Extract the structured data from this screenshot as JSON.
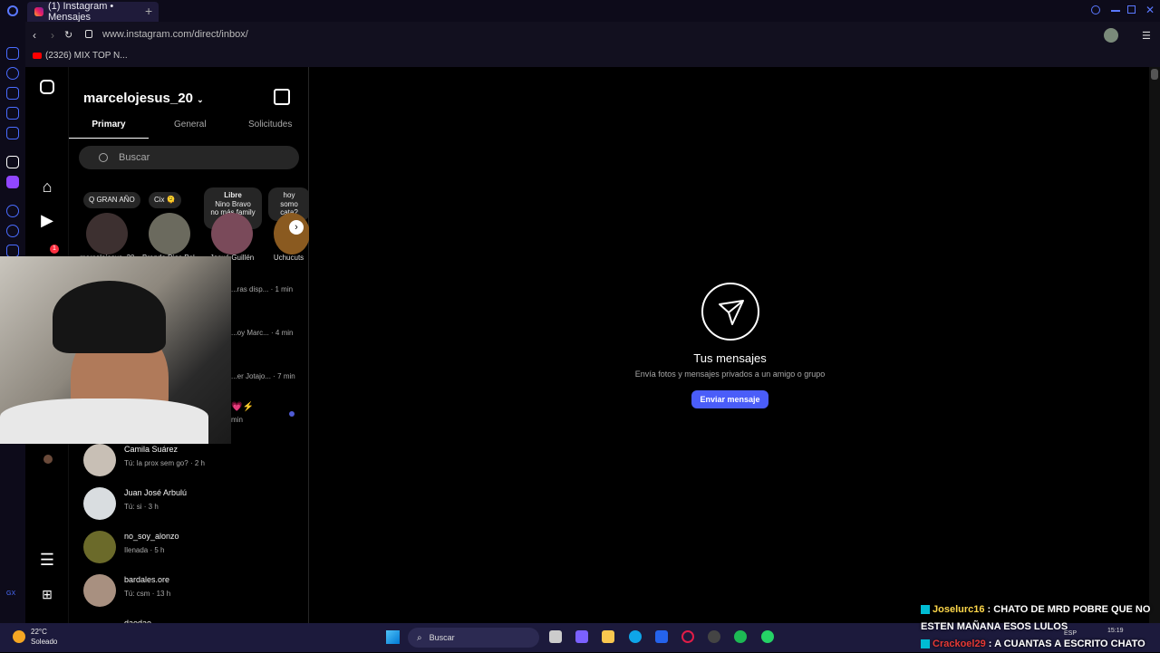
{
  "browser": {
    "tab_title": "(1) Instagram • Mensajes",
    "new_tab": "+",
    "url": "www.instagram.com/direct/inbox/",
    "bookmark": "(2326) MIX TOP N..."
  },
  "instagram": {
    "username": "marcelojesus_20",
    "tabs": [
      "Primary",
      "General",
      "Solicitudes"
    ],
    "search_placeholder": "Buscar",
    "notes": [
      {
        "text": "Q GRAN AÑO"
      },
      {
        "text": "Cix 🫠"
      },
      {
        "text": "Libre",
        "sub1": "Nino Bravo",
        "sub2": "no más family ..."
      },
      {
        "text": "hoy somo",
        "sub1": "cata?"
      }
    ],
    "stories": [
      "marcelojesus_20",
      "Brenda Dias Pal...",
      "Josué Guillén",
      "Uchucuts"
    ],
    "messages": [
      {
        "preview": "...ras disp...",
        "time": "· 1 min"
      },
      {
        "preview": "...oy Marc...",
        "time": "· 4 min"
      },
      {
        "preview": "...er Jotajo...",
        "time": "· 7 min"
      },
      {
        "preview": "💗⚡",
        "time": "min"
      },
      {
        "name": "Camila Suárez",
        "preview": "Tú: la prox sem go?",
        "time": "· 2 h"
      },
      {
        "name": "Juan José Arbulú",
        "preview": "Tú: si",
        "time": "· 3 h"
      },
      {
        "name": "no_soy_alonzo",
        "preview": "Ilenada",
        "time": "· 5 h"
      },
      {
        "name": "bardales.ore",
        "preview": "Tú: csm",
        "time": "· 13 h"
      },
      {
        "name": "daedae"
      }
    ],
    "notifications": "1",
    "empty_title": "Tus mensajes",
    "empty_sub": "Envía fotos y mensajes privados a un amigo o grupo",
    "send_button": "Enviar mensaje"
  },
  "taskbar": {
    "temp": "22°C",
    "weather": "Soleado",
    "search": "Buscar",
    "lang": "ESP",
    "time": "15:19"
  },
  "chat": [
    {
      "user": "Joselurc16",
      "text": ": CHATO DE MRD POBRE QUE NO ESTEN MAÑANA ESOS LULOS"
    },
    {
      "user": "Crackoel29",
      "text": ": A CUANTAS A ESCRITO CHATO"
    }
  ]
}
